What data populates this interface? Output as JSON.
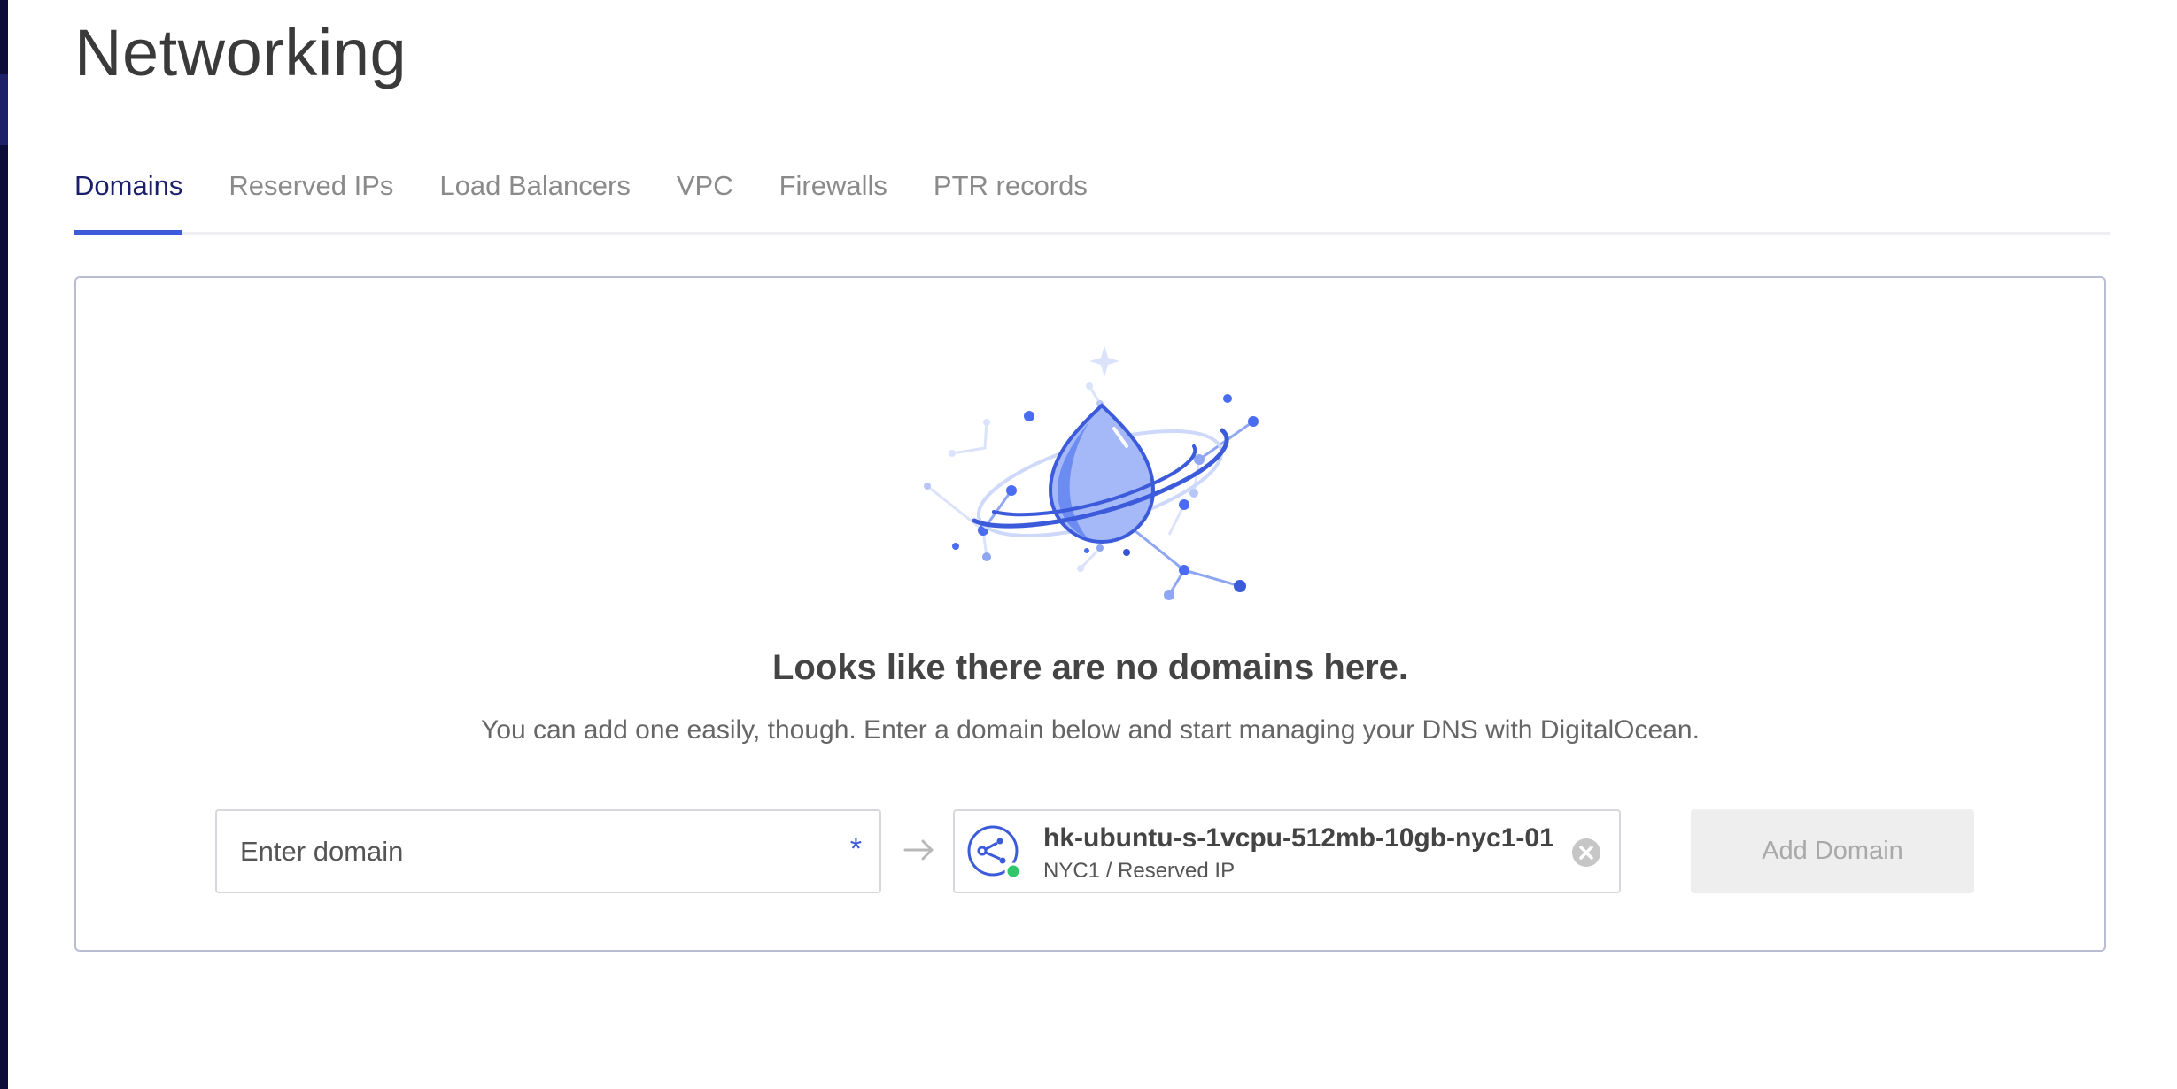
{
  "page": {
    "title": "Networking"
  },
  "tabs": [
    {
      "label": "Domains",
      "active": true
    },
    {
      "label": "Reserved IPs",
      "active": false
    },
    {
      "label": "Load Balancers",
      "active": false
    },
    {
      "label": "VPC",
      "active": false
    },
    {
      "label": "Firewalls",
      "active": false
    },
    {
      "label": "PTR records",
      "active": false
    }
  ],
  "empty_state": {
    "illustration_icon": "droplet-planet-illustration",
    "heading": "Looks like there are no domains here.",
    "description": "You can add one easily, though. Enter a domain below and start managing your DNS with DigitalOcean."
  },
  "form": {
    "domain_input": {
      "placeholder": "Enter domain",
      "value": "",
      "required_marker": "*"
    },
    "arrow_icon": "arrow-right-icon",
    "target": {
      "icon": "reserved-ip-icon",
      "status": "active",
      "name": "hk-ubuntu-s-1vcpu-512mb-10gb-nyc1-01",
      "subtitle": "NYC1 / Reserved IP",
      "clear_icon": "clear-icon"
    },
    "submit": {
      "label": "Add Domain",
      "disabled": true
    }
  },
  "colors": {
    "accent": "#3b5bdb",
    "active_tab_text": "#1b1f6b",
    "rail": "#0b0c3a",
    "status_online": "#2fc76a",
    "button_disabled_bg": "#eeeeee",
    "button_disabled_text": "#a9a9a9"
  }
}
